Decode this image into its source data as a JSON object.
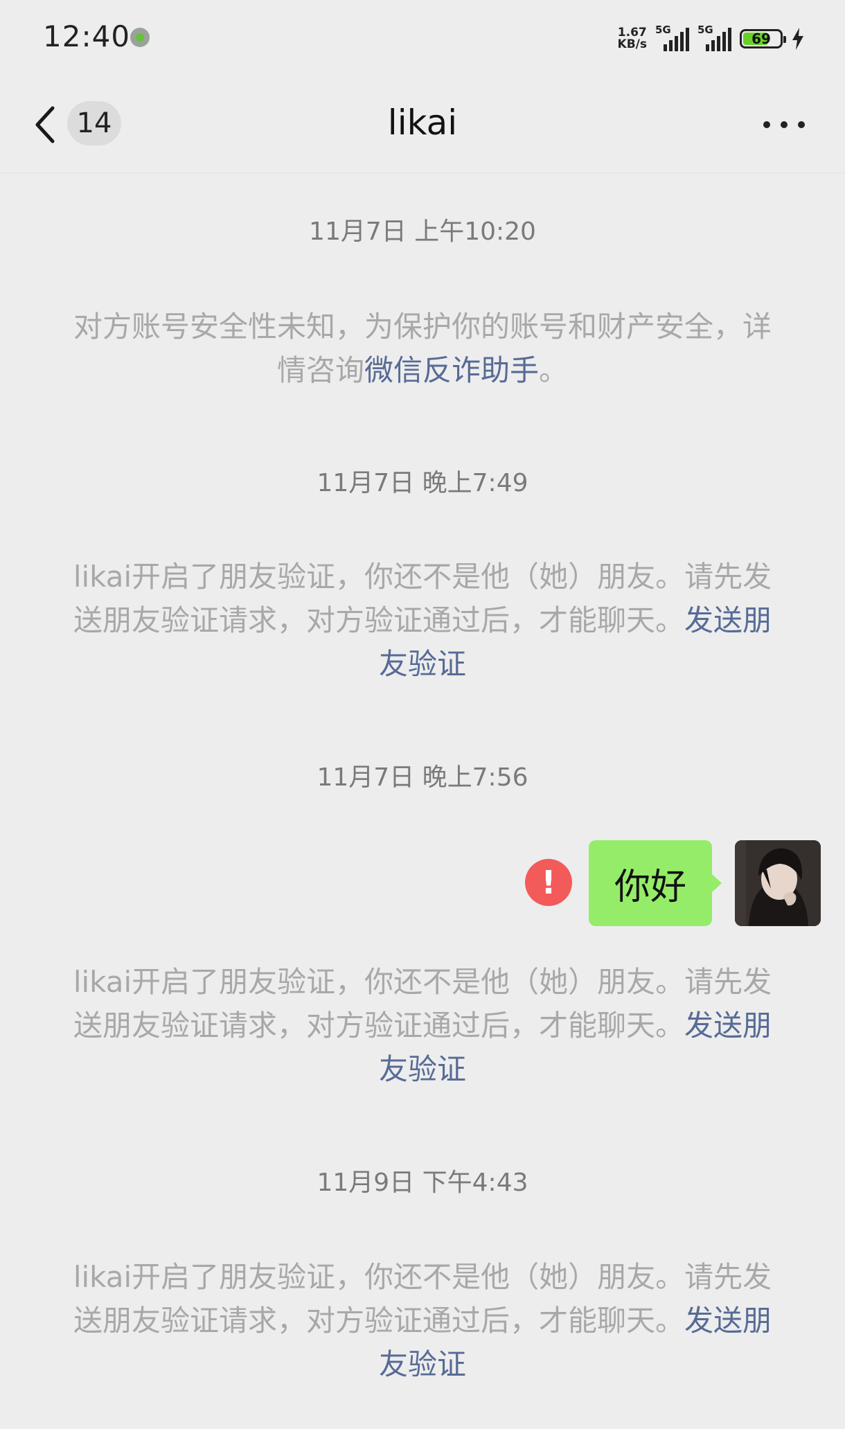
{
  "status_bar": {
    "time": "12:40",
    "net_speed_value": "1.67",
    "net_speed_unit": "KB/s",
    "sim1_tech": "5G",
    "sim2_tech": "5G",
    "battery_level": "69",
    "battery_color": "#69d02a",
    "icons": [
      "notification-app-icon",
      "signal-icon",
      "battery-icon",
      "charging-icon"
    ]
  },
  "nav": {
    "back_icon": "chevron-left-icon",
    "unread_count": "14",
    "title": "likai",
    "more_icon": "more-dots-icon"
  },
  "messages": {
    "ts1": "11月7日 上午10:20",
    "security_text": "对方账号安全性未知，为保护你的账号和财产安全，详情咨询",
    "security_link": "微信反诈助手",
    "security_end": "。",
    "ts2": "11月7日 晚上7:49",
    "verify1_text": "likai开启了朋友验证，你还不是他（她）朋友。请先发送朋友验证请求，对方验证通过后，才能聊天。",
    "verify1_link": "发送朋友验证",
    "ts3": "11月7日 晚上7:56",
    "outgoing_text": "你好",
    "outgoing_bubble_color": "#95ec69",
    "failed_icon": "exclamation-icon",
    "failed_icon_color": "#f35a5a",
    "verify2_text": "likai开启了朋友验证，你还不是他（她）朋友。请先发送朋友验证请求，对方验证通过后，才能聊天。",
    "verify2_link": "发送朋友验证",
    "ts4": "11月9日 下午4:43",
    "verify3_text": "likai开启了朋友验证，你还不是他（她）朋友。请先发送朋友验证请求，对方验证通过后，才能聊天。",
    "verify3_link": "发送朋友验证"
  },
  "colors": {
    "background": "#ededed",
    "link": "#576b95",
    "system_text": "#a8a8a8"
  }
}
